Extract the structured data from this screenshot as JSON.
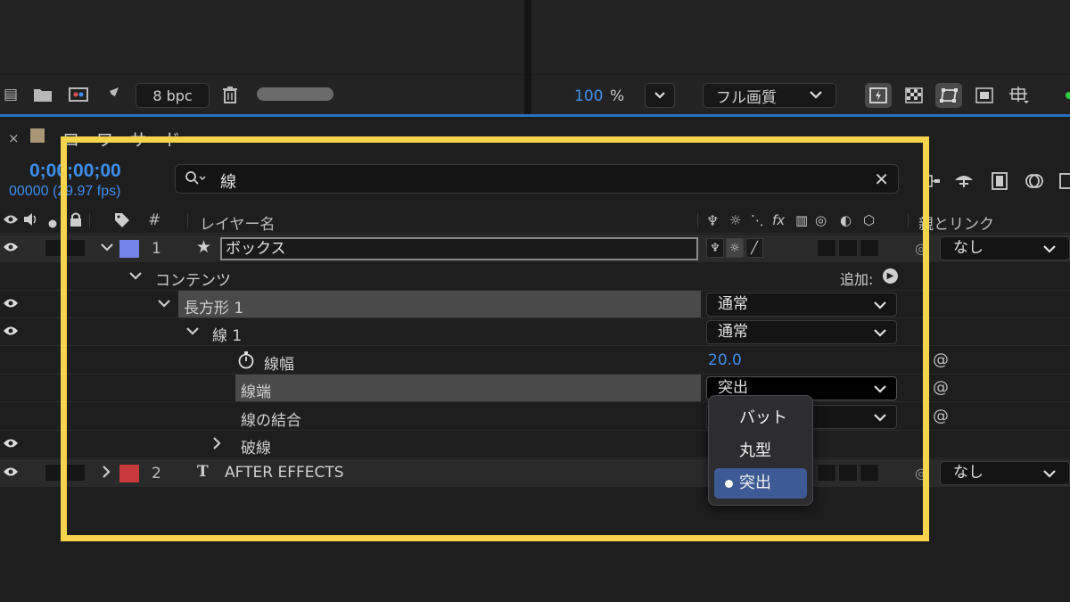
{
  "viewer": {
    "bpc": "8 bpc",
    "zoom_value": "100",
    "zoom_unit": "%",
    "quality": "フル画質"
  },
  "timeline": {
    "comp_name": "ローワーサード ー",
    "timecode": "0;00;00;00",
    "fps": "00000 (29.97 fps)",
    "search_text": "線",
    "columns": {
      "hash": "#",
      "layer_name": "レイヤー名",
      "parent": "親とリンク"
    },
    "layer1": {
      "number": "1",
      "name": "ボックス",
      "parent": "なし",
      "color": "#7383e8"
    },
    "contents": {
      "label": "コンテンツ",
      "add_label": "追加:"
    },
    "rect": {
      "label": "長方形 1",
      "blend": "通常"
    },
    "stroke": {
      "label": "線 1",
      "blend": "通常"
    },
    "stroke_width": {
      "label": "線幅",
      "value": "20.0"
    },
    "line_cap": {
      "label": "線端",
      "value": "突出"
    },
    "line_join": {
      "label": "線の結合"
    },
    "dashes": {
      "label": "破線"
    },
    "layer2": {
      "number": "2",
      "name": "AFTER EFFECTS",
      "parent": "なし",
      "color": "#c8393b"
    }
  },
  "popup": {
    "options": [
      "バット",
      "丸型",
      "突出"
    ],
    "selected": "突出"
  },
  "highlight_color": "#f8d44d"
}
